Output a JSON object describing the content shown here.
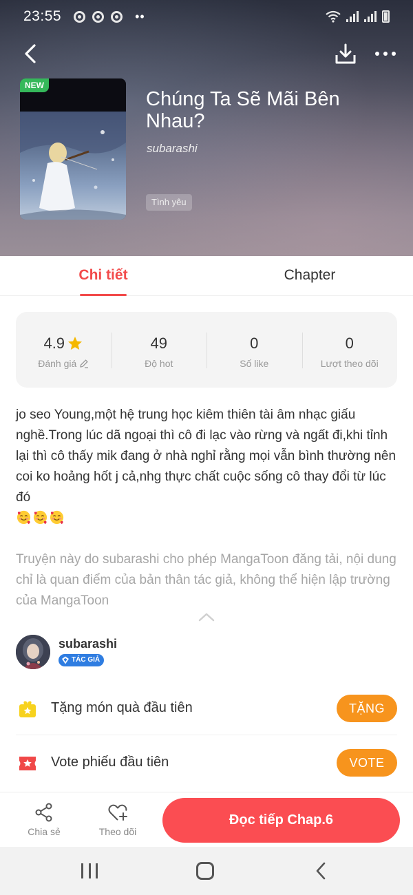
{
  "status_bar": {
    "time": "23:55",
    "more": "••"
  },
  "header": {
    "new_badge": "NEW",
    "title": "Chúng Ta Sẽ Mãi Bên Nhau?",
    "author": "subarashi",
    "genre": "Tình yêu"
  },
  "tabs": {
    "detail": "Chi tiết",
    "chapter": "Chapter",
    "active": "detail"
  },
  "stats": [
    {
      "value": "4.9",
      "label": "Đánh giá"
    },
    {
      "value": "49",
      "label": "Độ hot"
    },
    {
      "value": "0",
      "label": "Số like"
    },
    {
      "value": "0",
      "label": "Lượt theo dõi"
    }
  ],
  "description": "jo seo Young,một hệ trung học kiêm thiên tài âm nhạc giấu nghề.Trong lúc dã ngoại thì cô đi lạc vào rừng và ngất đi,khi tỉnh lại thì cô thấy mik đang ở nhà nghỉ rằng mọi vẫn bình thường nên coi ko hoảng hốt j cả,nhg thực chất cuộc sống cô thay đổi từ lúc đó",
  "emoji_count": 3,
  "disclaimer": "Truyện này do subarashi cho phép MangaToon đăng tải, nội dung chỉ là quan điểm của bản thân tác giả, không thể hiện lập trường của MangaToon",
  "author_card": {
    "name": "subarashi",
    "badge": "TÁC GIẢ"
  },
  "actions": {
    "gift_text": "Tặng món quà đầu tiên",
    "gift_button": "TẶNG",
    "vote_text": "Vote phiếu đầu tiên",
    "vote_button": "VOTE"
  },
  "bottom_bar": {
    "share": "Chia sẻ",
    "follow": "Theo dõi",
    "read": "Đọc tiếp Chap.6"
  },
  "colors": {
    "accent": "#f24b4b",
    "read_button": "#fb4d52",
    "action_button": "#f7941d",
    "new_badge": "#35b85a",
    "author_badge": "#2f7de1",
    "star": "#f5b800"
  }
}
